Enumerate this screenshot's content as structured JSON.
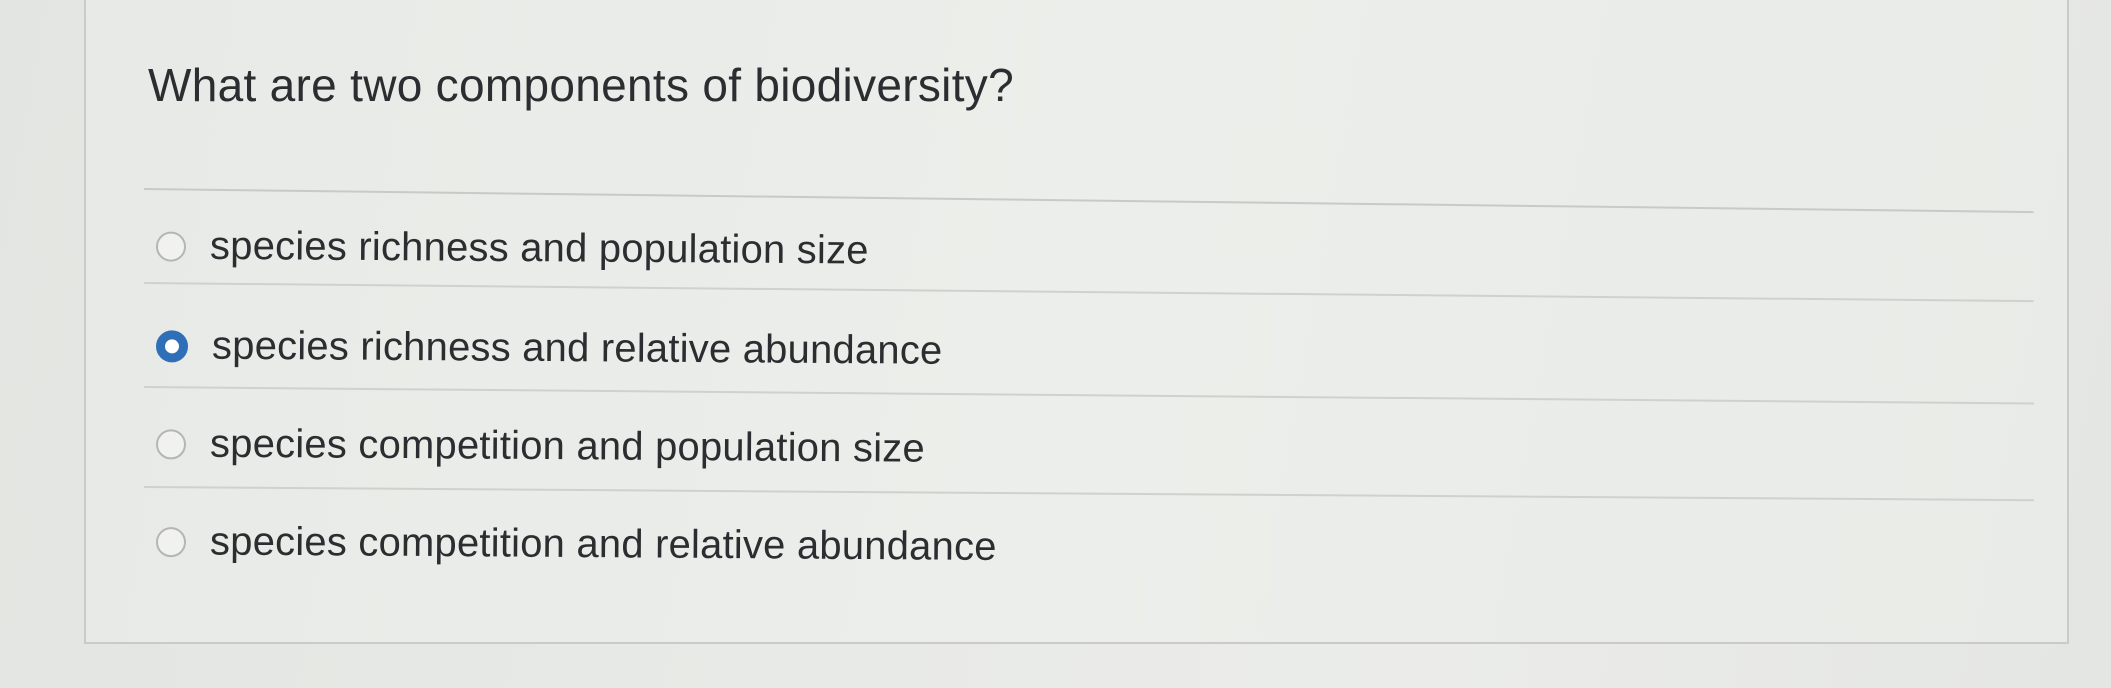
{
  "question": {
    "text": "What are two components of biodiversity?"
  },
  "options": [
    {
      "label": "species richness and population size",
      "selected": false
    },
    {
      "label": "species richness and relative abundance",
      "selected": true
    },
    {
      "label": "species competition and population size",
      "selected": false
    },
    {
      "label": "species competition and relative abundance",
      "selected": false
    }
  ],
  "colors": {
    "selected_radio": "#2f6fb7",
    "text": "#2c2d30",
    "background": "#e9ebe8"
  }
}
